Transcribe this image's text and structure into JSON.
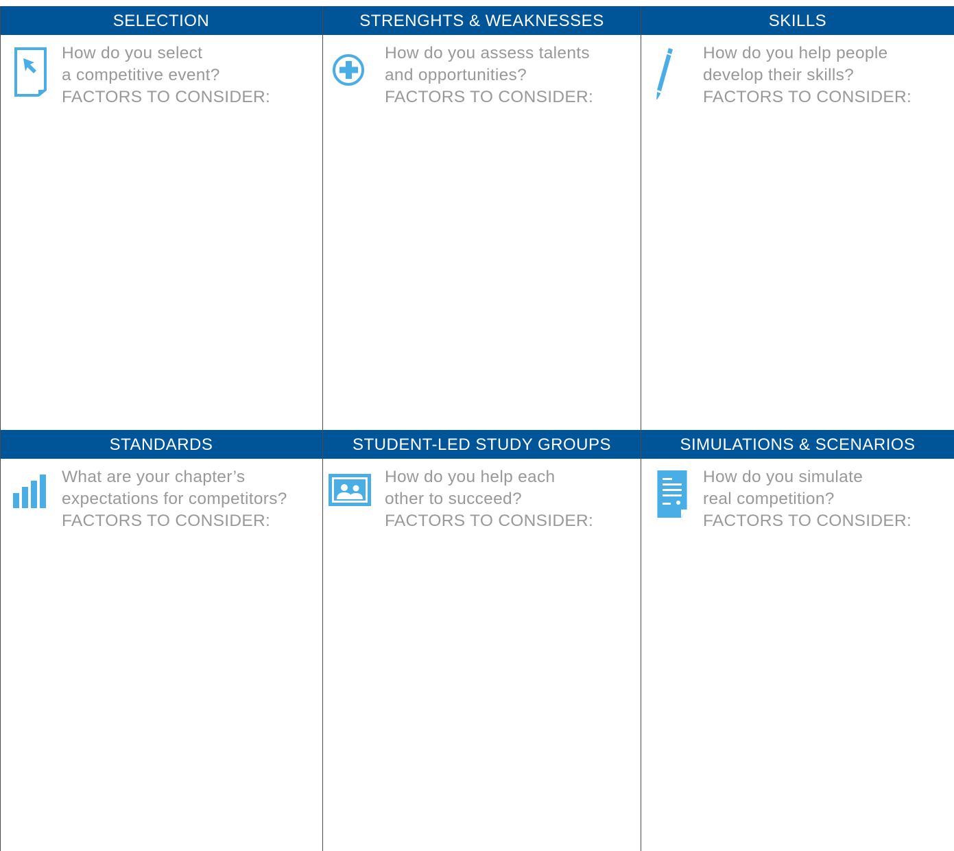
{
  "rows": [
    {
      "cells": [
        {
          "header": "SELECTION",
          "icon": "cursor-document-icon",
          "line1": "How do you select",
          "line2": "a competitive event?",
          "line3": "FACTORS TO CONSIDER:"
        },
        {
          "header": "STRENGHTS & WEAKNESSES",
          "icon": "plus-circle-icon",
          "line1": "How do you assess talents",
          "line2": "and opportunities?",
          "line3": "FACTORS TO CONSIDER:"
        },
        {
          "header": "SKILLS",
          "icon": "pencil-icon",
          "line1": "How do you help people",
          "line2": "develop their skills?",
          "line3": "FACTORS TO CONSIDER:"
        }
      ]
    },
    {
      "cells": [
        {
          "header": "STANDARDS",
          "icon": "bar-chart-icon",
          "line1": "What are your chapter’s",
          "line2": "expectations for competitors?",
          "line3": "FACTORS TO CONSIDER:"
        },
        {
          "header": "STUDENT-LED STUDY GROUPS",
          "icon": "group-photo-icon",
          "line1": "How do you help each",
          "line2": "other to succeed?",
          "line3": "FACTORS TO CONSIDER:"
        },
        {
          "header": "SIMULATIONS & SCENARIOS",
          "icon": "document-lines-icon",
          "line1": "How do you simulate",
          "line2": "real competition?",
          "line3": "FACTORS TO CONSIDER:"
        }
      ]
    }
  ],
  "colors": {
    "header_bg": "#005599",
    "header_text": "#ffffff",
    "prompt_text": "#999999",
    "icon": "#4aaee6",
    "grid_line": "#4a4a4a"
  }
}
